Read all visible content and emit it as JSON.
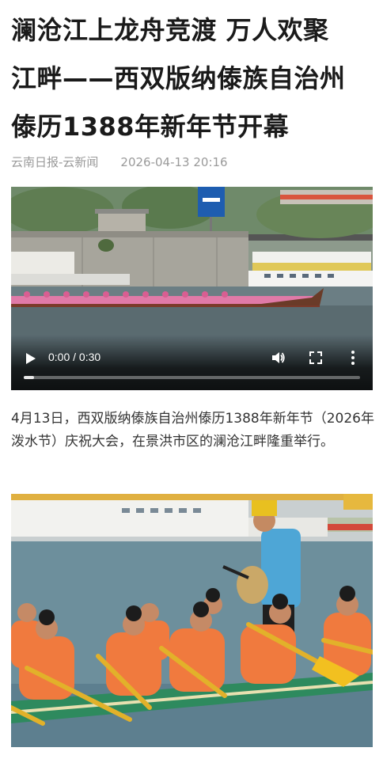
{
  "article": {
    "title_lines": [
      "澜沧江上龙舟竞渡 万人欢聚",
      "江畔——西双版纳傣族自治州",
      "傣历1388年新年节开幕"
    ],
    "source": "云南日报-云新闻",
    "datetime": "2026-04-13 20:16",
    "paragraph": "4月13日，西双版纳傣族自治州傣历1388年新年节（2026年泼水节）庆祝大会，在景洪市区的澜沧江畔隆重举行。"
  },
  "video": {
    "time_display": "0:00 / 0:30",
    "progress": 0.03,
    "controls": [
      "play-icon",
      "volume-icon",
      "fullscreen-icon",
      "more-icon"
    ]
  },
  "colors": {
    "title": "#1a1a1a",
    "meta": "#9a9a9a",
    "body": "#333333",
    "costume": "#f07a3e",
    "river": "#5d7f8f"
  }
}
